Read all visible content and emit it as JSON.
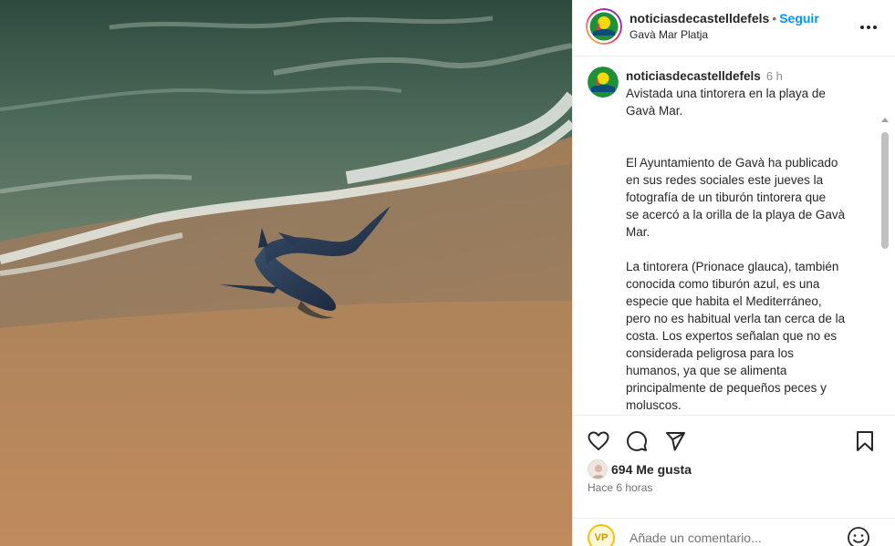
{
  "post": {
    "username": "noticiasdecastelldefels",
    "separator": "•",
    "follow_label": "Seguir",
    "location": "Gavà Mar Platja",
    "more_icon": "more-horizontal-icon"
  },
  "caption": {
    "username": "noticiasdecastelldefels",
    "time": "6 h",
    "title_line1": "Avistada una tintorera en la playa de",
    "title_line2": "Gavà Mar.",
    "para1": [
      "El Ayuntamiento de Gavà ha publicado",
      "en sus redes sociales este jueves la",
      "fotografía de un tiburón tintorera que",
      "se acercó a la orilla de la playa de Gavà",
      "Mar."
    ],
    "para2": [
      "La tintorera (Prionace glauca), también",
      "conocida como tiburón azul, es una",
      "especie que habita el Mediterráneo,",
      "pero no es habitual verla tan cerca de la",
      "costa. Los expertos señalan que no es",
      "considerada peligrosa para los",
      "humanos, ya que se alimenta",
      "principalmente de pequeños peces y",
      "moluscos."
    ]
  },
  "actions": {
    "like_icon": "heart-icon",
    "comment_icon": "comment-icon",
    "share_icon": "send-icon",
    "save_icon": "bookmark-icon"
  },
  "likes": {
    "count_label": "694 Me gusta"
  },
  "time_ago": "Hace 6 horas",
  "comment": {
    "avatar_text": "VP",
    "placeholder": "Añade un comentario...",
    "emoji_icon": "smiley-icon"
  },
  "colors": {
    "follow": "#0095f6",
    "text": "#262626",
    "muted": "#737373",
    "sand": "#b9875a",
    "sea": "#4e6a52"
  }
}
